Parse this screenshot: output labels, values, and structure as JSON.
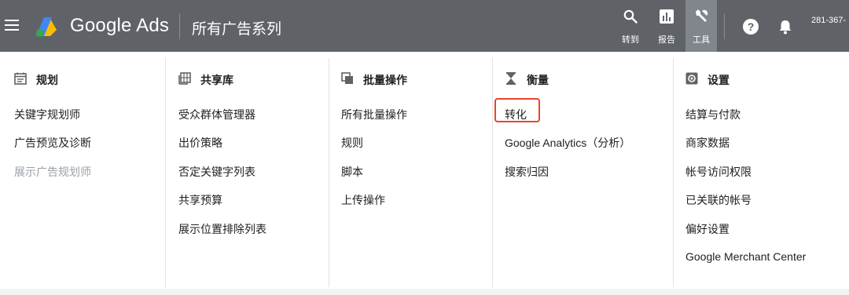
{
  "topbar": {
    "brand": "Google Ads",
    "page_title": "所有广告系列",
    "tools": [
      {
        "label": "转到",
        "icon": "search-icon"
      },
      {
        "label": "报告",
        "icon": "bar-chart-icon"
      },
      {
        "label": "工具",
        "icon": "wrench-icon"
      }
    ],
    "account_id": "281-367-"
  },
  "colors": {
    "topbar_bg": "#5f6368",
    "active_tool_bg": "#80868b",
    "highlight_border": "#e8452c"
  },
  "menu": {
    "columns": [
      {
        "heading": "规划",
        "icon": "calendar-icon",
        "items": [
          {
            "label": "关键字规划师",
            "disabled": false
          },
          {
            "label": "广告预览及诊断",
            "disabled": false
          },
          {
            "label": "展示广告规划师",
            "disabled": true
          }
        ]
      },
      {
        "heading": "共享库",
        "icon": "library-grid-icon",
        "items": [
          {
            "label": "受众群体管理器"
          },
          {
            "label": "出价策略"
          },
          {
            "label": "否定关键字列表"
          },
          {
            "label": "共享预算"
          },
          {
            "label": "展示位置排除列表"
          }
        ]
      },
      {
        "heading": "批量操作",
        "icon": "copy-stack-icon",
        "items": [
          {
            "label": "所有批量操作"
          },
          {
            "label": "规则"
          },
          {
            "label": "脚本"
          },
          {
            "label": "上传操作"
          }
        ]
      },
      {
        "heading": "衡量",
        "icon": "hourglass-icon",
        "items": [
          {
            "label": "转化",
            "highlighted": true
          },
          {
            "label": "Google Analytics（分析）"
          },
          {
            "label": "搜索归因"
          }
        ]
      },
      {
        "heading": "设置",
        "icon": "settings-box-icon",
        "items": [
          {
            "label": "结算与付款"
          },
          {
            "label": "商家数据"
          },
          {
            "label": "帐号访问权限"
          },
          {
            "label": "已关联的帐号"
          },
          {
            "label": "偏好设置"
          },
          {
            "label": "Google Merchant Center"
          }
        ]
      }
    ]
  }
}
